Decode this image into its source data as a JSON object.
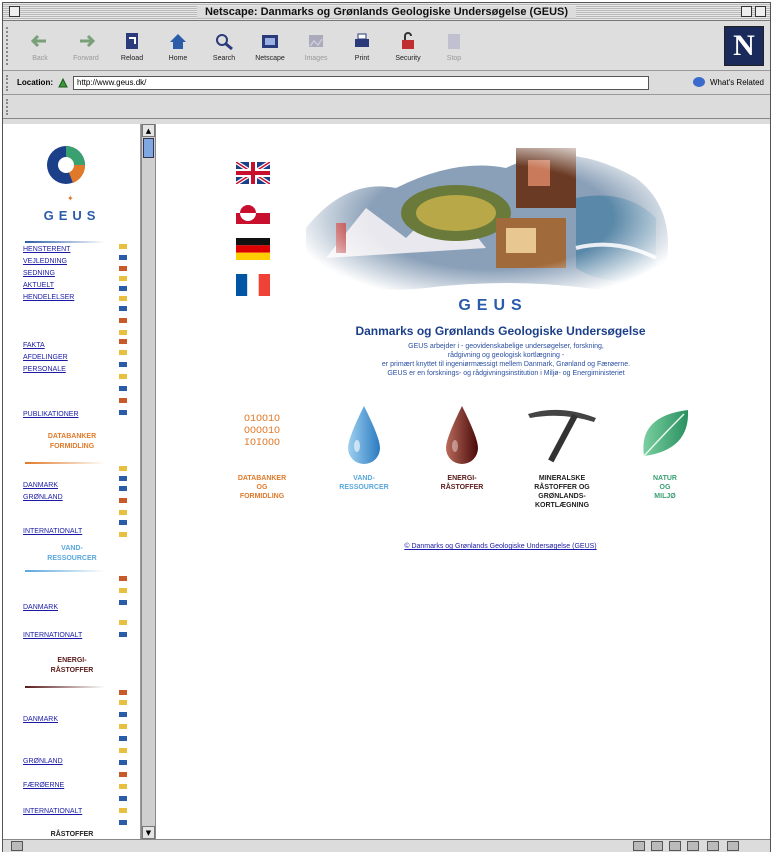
{
  "window": {
    "title": "Netscape: Danmarks og Grønlands Geologiske Undersøgelse (GEUS)"
  },
  "toolbar": {
    "buttons": [
      {
        "label": "Back",
        "icon": "back-arrow-icon",
        "disabled": true
      },
      {
        "label": "Forward",
        "icon": "forward-arrow-icon",
        "disabled": true
      },
      {
        "label": "Reload",
        "icon": "reload-icon",
        "disabled": false
      },
      {
        "label": "Home",
        "icon": "home-icon",
        "disabled": false
      },
      {
        "label": "Search",
        "icon": "search-icon",
        "disabled": false
      },
      {
        "label": "Netscape",
        "icon": "netscape-icon",
        "disabled": false
      },
      {
        "label": "Images",
        "icon": "images-icon",
        "disabled": true
      },
      {
        "label": "Print",
        "icon": "print-icon",
        "disabled": false
      },
      {
        "label": "Security",
        "icon": "security-lock-icon",
        "disabled": false
      },
      {
        "label": "Stop",
        "icon": "stop-icon",
        "disabled": true
      }
    ],
    "logo_letter": "N"
  },
  "location": {
    "label": "Location:",
    "url": "http://www.geus.dk/",
    "related_label": "What's Related"
  },
  "leftnav": {
    "logo_text": "GEUS",
    "group1": [
      "HENSTERENT",
      "VEJLEDNING",
      "SEDNING",
      "AKTUELT",
      "HENDELELSER"
    ],
    "group2": [
      "FAKTA",
      "AFDELINGER",
      "PERSONALE"
    ],
    "group3": [
      "PUBLIKATIONER"
    ],
    "head_data": [
      "DATABANKER",
      "FORMIDLING"
    ],
    "group4": [
      "DANMARK",
      "GRØNLAND",
      "INTERNATIONALT"
    ],
    "head_vand": [
      "VAND-",
      "RESSOURCER"
    ],
    "group5": [
      "DANMARK",
      "INTERNATIONALT"
    ],
    "head_energi": [
      "ENERGI-",
      "RÅSTOFFER"
    ],
    "group6": [
      "DANMARK",
      "GRØNLAND",
      "FÆRØERNE",
      "INTERNATIONALT"
    ],
    "head_raa": "RÅSTOFFER"
  },
  "main": {
    "logo_text": "GEUS",
    "org_name": "Danmarks og Grønlands Geologiske Undersøgelse",
    "description": [
      "GEUS arbejder i - geovidenskabelige undersøgelser, forskning,",
      "rådgivning og geologisk kortlægning -",
      "er primært knyttet til ingeniørmæssigt mellem Danmark, Grønland og Færøerne.",
      "GEUS er en forsknings- og rådgivningsinstitution i Miljø- og Energiministeriet"
    ],
    "categories": [
      {
        "lines": [
          "DATABANKER",
          "OG",
          "FORMIDLING"
        ],
        "color": "#e07a2a",
        "icon": "binary-data-icon"
      },
      {
        "lines": [
          "VAND-",
          "RESSOURCER"
        ],
        "color": "#5aa7dc",
        "icon": "water-drop-icon"
      },
      {
        "lines": [
          "ENERGI-",
          "RÅSTOFFER"
        ],
        "color": "#5a1a1a",
        "icon": "oil-drop-icon"
      },
      {
        "lines": [
          "MINERALSKE",
          "RÅSTOFFER OG",
          "GRØNLANDS-",
          "KORTLÆGNING"
        ],
        "color": "#222222",
        "icon": "pickaxe-icon"
      },
      {
        "lines": [
          "NATUR",
          "OG",
          "MILJØ"
        ],
        "color": "#3aa070",
        "icon": "leaf-icon"
      }
    ],
    "binary_text": [
      "O1OO1O",
      "OOOO1O",
      "IOIOOO"
    ],
    "copyright": "© Danmarks og Grønlands Geologiske Undersøgelse (GEUS)",
    "flags": [
      "uk-flag-icon",
      "greenland-flag-icon",
      "germany-flag-icon",
      "france-flag-icon"
    ]
  },
  "colors": {
    "accent": "#2a5caa",
    "link": "#1a1aa6",
    "orange": "#e07a2a",
    "water": "#5aa7dc"
  }
}
